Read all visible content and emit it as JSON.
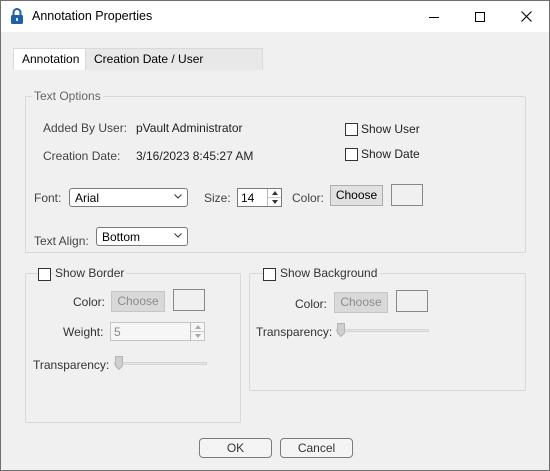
{
  "window": {
    "title": "Annotation Properties",
    "icon": "lock-icon"
  },
  "tabs": [
    {
      "label": "Annotation",
      "selected": false
    },
    {
      "label": "Creation Date / User Information",
      "selected": true
    }
  ],
  "text_options": {
    "group_label": "Text Options",
    "added_by_label": "Added By User:",
    "added_by_value": "pVault Administrator",
    "creation_date_label": "Creation Date:",
    "creation_date_value": "3/16/2023 8:45:27 AM",
    "show_user_label": "Show User",
    "show_user_checked": false,
    "show_date_label": "Show Date",
    "show_date_checked": false,
    "font_label": "Font:",
    "font_value": "Arial",
    "size_label": "Size:",
    "size_value": "14",
    "color_label": "Color:",
    "choose_label": "Choose",
    "text_align_label": "Text Align:",
    "text_align_value": "Bottom"
  },
  "border": {
    "show_label": "Show Border",
    "checked": false,
    "color_label": "Color:",
    "choose_label": "Choose",
    "weight_label": "Weight:",
    "weight_value": "5",
    "transparency_label": "Transparency:",
    "transparency_level": 0
  },
  "background": {
    "show_label": "Show Background",
    "checked": false,
    "color_label": "Color:",
    "choose_label": "Choose",
    "transparency_label": "Transparency:",
    "transparency_level": 0
  },
  "footer": {
    "ok_label": "OK",
    "cancel_label": "Cancel"
  },
  "colors": {
    "window_bg": "#f0f0f0",
    "button_bg": "#e1e1e1",
    "disabled_text": "#8c8c8c"
  }
}
